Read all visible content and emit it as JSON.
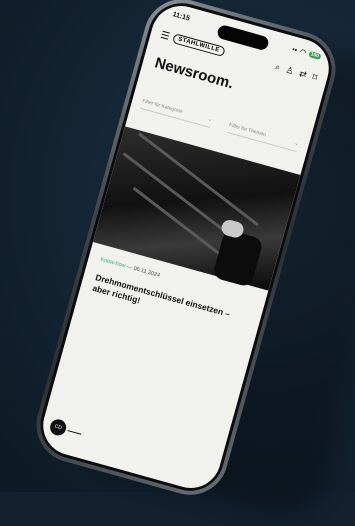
{
  "status": {
    "time": "11:15",
    "battery": "100"
  },
  "nav": {
    "logo_text": "STAHLWILLE",
    "icons": [
      "menu-icon",
      "search-icon",
      "user-icon",
      "compare-icon",
      "bookmark-icon"
    ]
  },
  "page": {
    "title": "Newsroom."
  },
  "filters": [
    {
      "label": "Filter für Kategorie",
      "chevron": "⌄"
    },
    {
      "label": "Filter für Themen",
      "chevron": "⌄"
    }
  ],
  "article": {
    "tag": "Know-how",
    "separator": "—",
    "date": "06.11.2024",
    "headline": "Drehmomentschlüssel einsetzen – aber richtig!"
  },
  "cookie_badge": {
    "label": "CD"
  },
  "colors": {
    "background": "#122030",
    "screen": "#f1f1ee",
    "accent": "#3aa58c"
  }
}
